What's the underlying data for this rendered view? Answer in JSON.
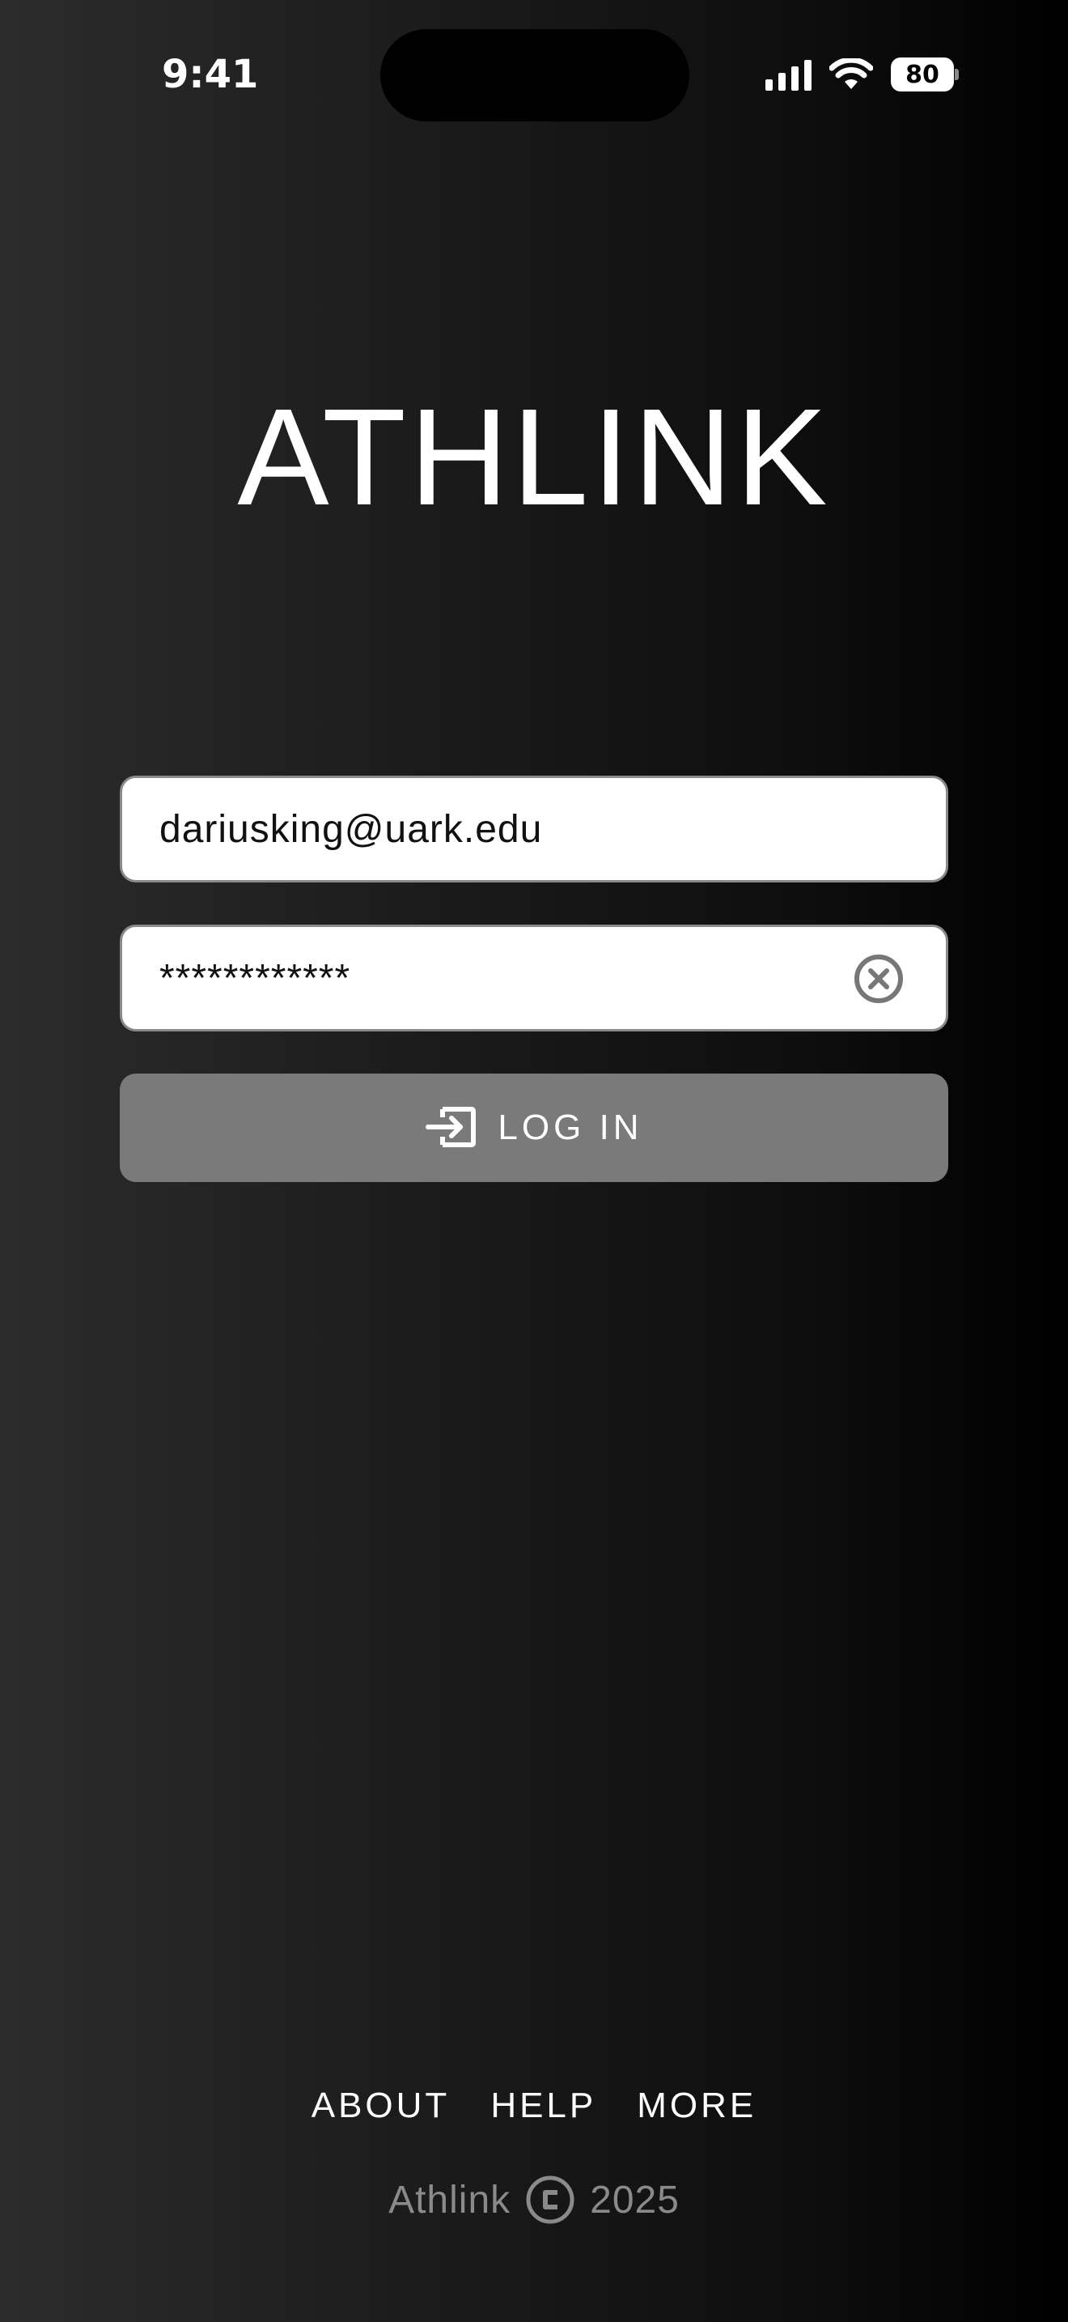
{
  "status_bar": {
    "time": "9:41",
    "battery_level": "80"
  },
  "app": {
    "title": "ATHLINK"
  },
  "login_form": {
    "email_value": "dariusking@uark.edu",
    "password_value": "************",
    "login_label": "LOG IN"
  },
  "footer": {
    "links": [
      "ABOUT",
      "HELP",
      "MORE"
    ],
    "brand": "Athlink",
    "year": "2025"
  },
  "colors": {
    "background_start": "#2c2c2c",
    "background_end": "#000000",
    "button": "#7a7a7a",
    "footer_text": "#8a8a8a"
  },
  "icons": {
    "login": "login-arrow-icon",
    "clear": "clear-circle-x-icon",
    "copyright": "copyright-icon"
  }
}
